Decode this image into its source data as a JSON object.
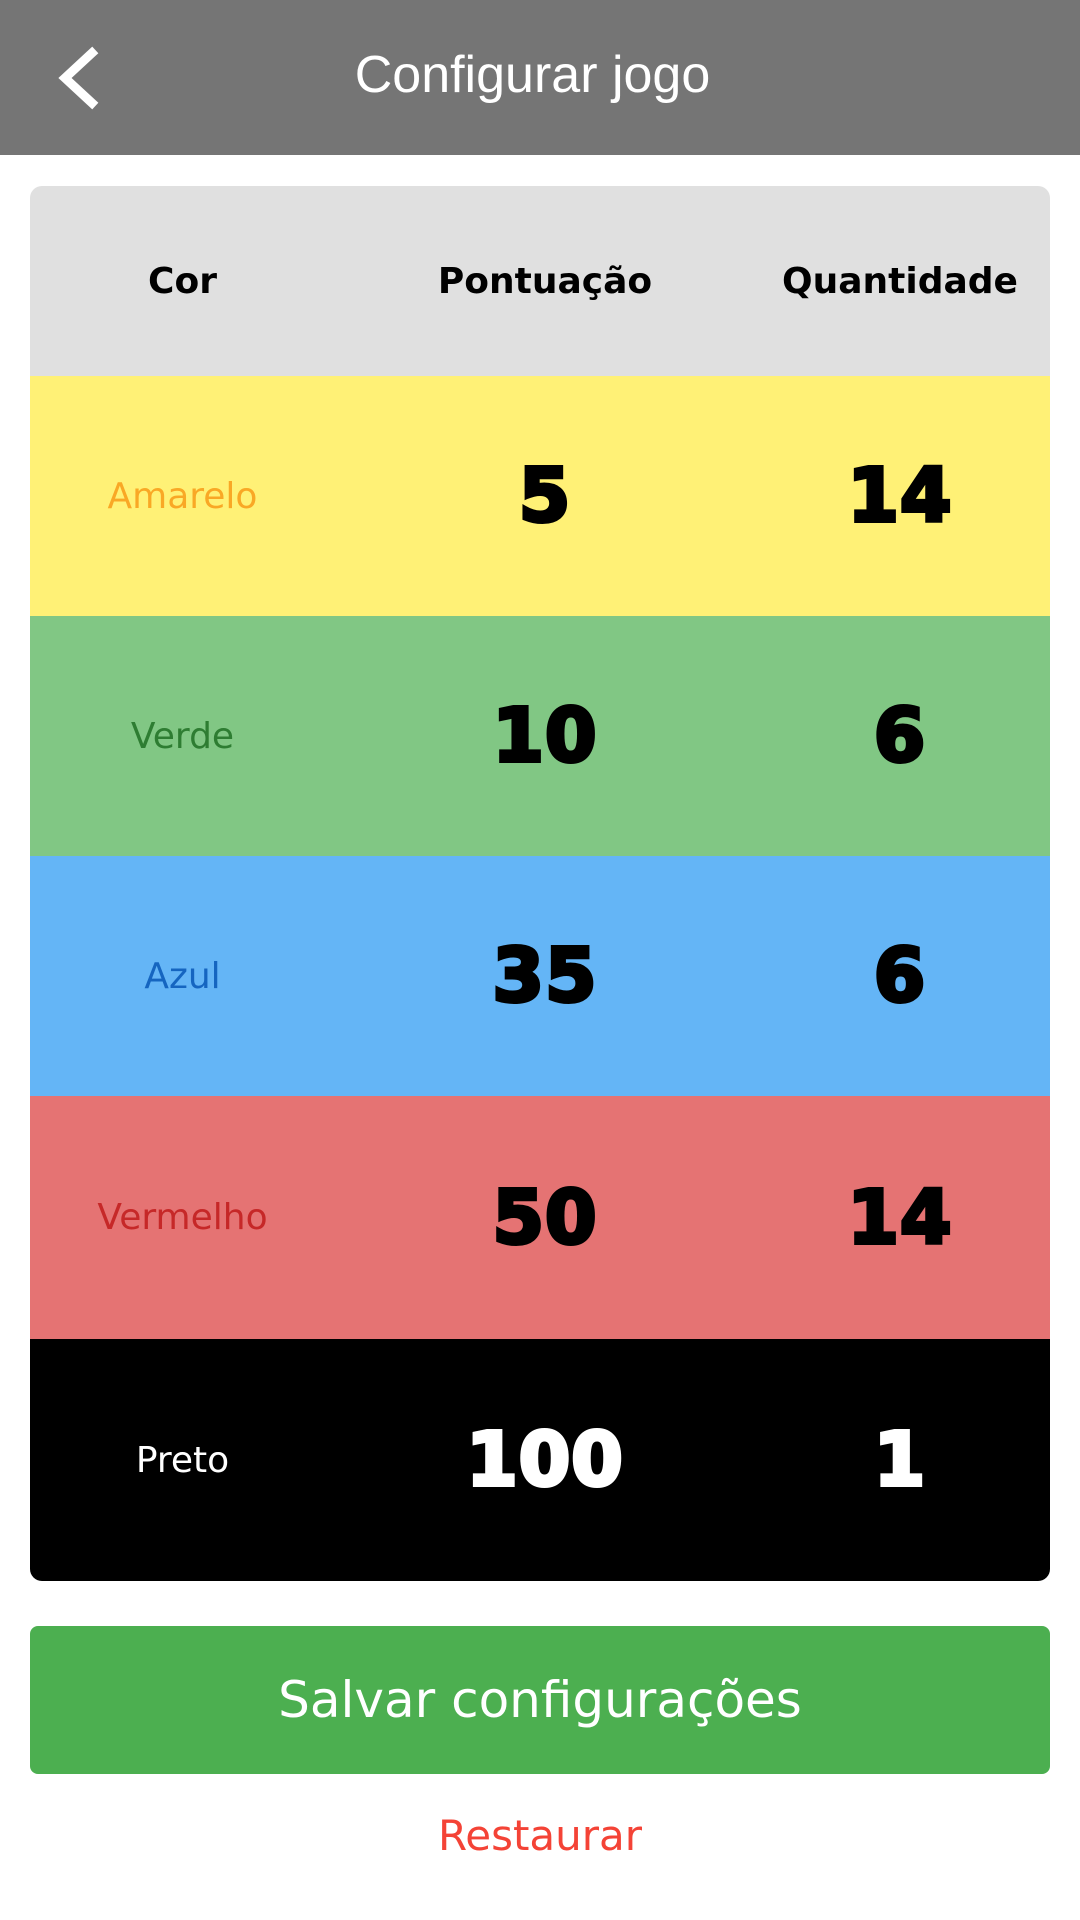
{
  "app_bar": {
    "title": "Configurar jogo",
    "back_icon": "chevron-left-icon",
    "background": "#757575"
  },
  "table": {
    "headers": {
      "color": "Cor",
      "score": "Pontuação",
      "quantity": "Quantidade"
    },
    "rows": [
      {
        "name": "Amarelo",
        "score": "5",
        "quantity": "14",
        "bg": "#fff176",
        "name_color": "#f9a825",
        "num_color": "#000000"
      },
      {
        "name": "Verde",
        "score": "10",
        "quantity": "6",
        "bg": "#81c784",
        "name_color": "#2e7d32",
        "num_color": "#000000"
      },
      {
        "name": "Azul",
        "score": "35",
        "quantity": "6",
        "bg": "#64b5f6",
        "name_color": "#1565c0",
        "num_color": "#000000"
      },
      {
        "name": "Vermelho",
        "score": "50",
        "quantity": "14",
        "bg": "#e57373",
        "name_color": "#c62828",
        "num_color": "#000000"
      },
      {
        "name": "Preto",
        "score": "100",
        "quantity": "1",
        "bg": "#000000",
        "name_color": "#ffffff",
        "num_color": "#ffffff"
      }
    ]
  },
  "actions": {
    "save_label": "Salvar configurações",
    "save_color": "#4caf50",
    "restore_label": "Restaurar",
    "restore_color": "#f44336"
  }
}
